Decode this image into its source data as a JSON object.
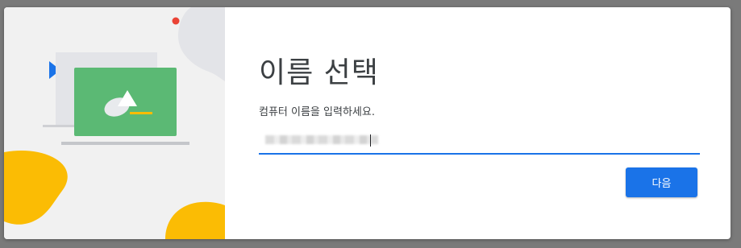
{
  "dialog": {
    "title": "이름 선택",
    "subtitle": "컴퓨터 이름을 입력하세요.",
    "name_field": {
      "value": "",
      "state": "focused, value obscured"
    },
    "next_button_label": "다음"
  },
  "colors": {
    "accent": "#1a73e8",
    "illustration_bg": "#f1f1f1",
    "green_screen": "#5bb974",
    "yellow_blob": "#fbbc04",
    "red_dot": "#ea4335"
  },
  "icons": [
    "play-triangle-icon",
    "laptop-illustration",
    "red-dot-icon",
    "yellow-blob-shape"
  ]
}
